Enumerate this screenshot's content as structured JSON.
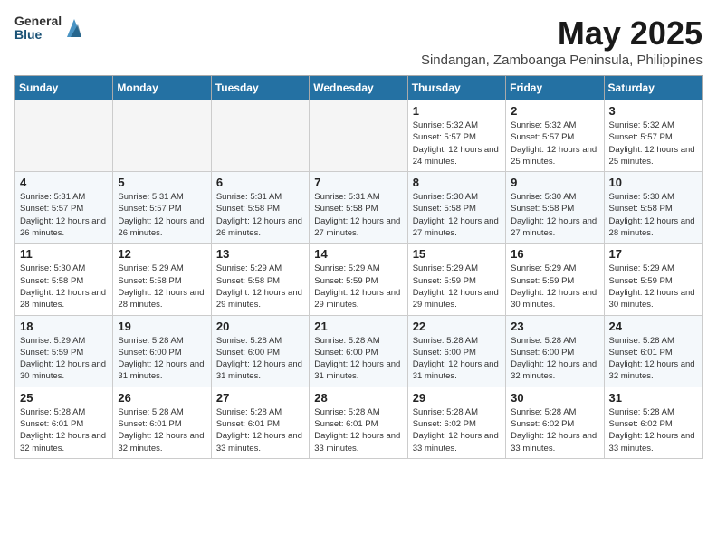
{
  "header": {
    "logo": {
      "general": "General",
      "blue": "Blue"
    },
    "title": "May 2025",
    "location": "Sindangan, Zamboanga Peninsula, Philippines"
  },
  "weekdays": [
    "Sunday",
    "Monday",
    "Tuesday",
    "Wednesday",
    "Thursday",
    "Friday",
    "Saturday"
  ],
  "weeks": [
    [
      {
        "day": "",
        "sunrise": "",
        "sunset": "",
        "daylight": ""
      },
      {
        "day": "",
        "sunrise": "",
        "sunset": "",
        "daylight": ""
      },
      {
        "day": "",
        "sunrise": "",
        "sunset": "",
        "daylight": ""
      },
      {
        "day": "",
        "sunrise": "",
        "sunset": "",
        "daylight": ""
      },
      {
        "day": "1",
        "sunrise": "Sunrise: 5:32 AM",
        "sunset": "Sunset: 5:57 PM",
        "daylight": "Daylight: 12 hours and 24 minutes."
      },
      {
        "day": "2",
        "sunrise": "Sunrise: 5:32 AM",
        "sunset": "Sunset: 5:57 PM",
        "daylight": "Daylight: 12 hours and 25 minutes."
      },
      {
        "day": "3",
        "sunrise": "Sunrise: 5:32 AM",
        "sunset": "Sunset: 5:57 PM",
        "daylight": "Daylight: 12 hours and 25 minutes."
      }
    ],
    [
      {
        "day": "4",
        "sunrise": "Sunrise: 5:31 AM",
        "sunset": "Sunset: 5:57 PM",
        "daylight": "Daylight: 12 hours and 26 minutes."
      },
      {
        "day": "5",
        "sunrise": "Sunrise: 5:31 AM",
        "sunset": "Sunset: 5:57 PM",
        "daylight": "Daylight: 12 hours and 26 minutes."
      },
      {
        "day": "6",
        "sunrise": "Sunrise: 5:31 AM",
        "sunset": "Sunset: 5:58 PM",
        "daylight": "Daylight: 12 hours and 26 minutes."
      },
      {
        "day": "7",
        "sunrise": "Sunrise: 5:31 AM",
        "sunset": "Sunset: 5:58 PM",
        "daylight": "Daylight: 12 hours and 27 minutes."
      },
      {
        "day": "8",
        "sunrise": "Sunrise: 5:30 AM",
        "sunset": "Sunset: 5:58 PM",
        "daylight": "Daylight: 12 hours and 27 minutes."
      },
      {
        "day": "9",
        "sunrise": "Sunrise: 5:30 AM",
        "sunset": "Sunset: 5:58 PM",
        "daylight": "Daylight: 12 hours and 27 minutes."
      },
      {
        "day": "10",
        "sunrise": "Sunrise: 5:30 AM",
        "sunset": "Sunset: 5:58 PM",
        "daylight": "Daylight: 12 hours and 28 minutes."
      }
    ],
    [
      {
        "day": "11",
        "sunrise": "Sunrise: 5:30 AM",
        "sunset": "Sunset: 5:58 PM",
        "daylight": "Daylight: 12 hours and 28 minutes."
      },
      {
        "day": "12",
        "sunrise": "Sunrise: 5:29 AM",
        "sunset": "Sunset: 5:58 PM",
        "daylight": "Daylight: 12 hours and 28 minutes."
      },
      {
        "day": "13",
        "sunrise": "Sunrise: 5:29 AM",
        "sunset": "Sunset: 5:58 PM",
        "daylight": "Daylight: 12 hours and 29 minutes."
      },
      {
        "day": "14",
        "sunrise": "Sunrise: 5:29 AM",
        "sunset": "Sunset: 5:59 PM",
        "daylight": "Daylight: 12 hours and 29 minutes."
      },
      {
        "day": "15",
        "sunrise": "Sunrise: 5:29 AM",
        "sunset": "Sunset: 5:59 PM",
        "daylight": "Daylight: 12 hours and 29 minutes."
      },
      {
        "day": "16",
        "sunrise": "Sunrise: 5:29 AM",
        "sunset": "Sunset: 5:59 PM",
        "daylight": "Daylight: 12 hours and 30 minutes."
      },
      {
        "day": "17",
        "sunrise": "Sunrise: 5:29 AM",
        "sunset": "Sunset: 5:59 PM",
        "daylight": "Daylight: 12 hours and 30 minutes."
      }
    ],
    [
      {
        "day": "18",
        "sunrise": "Sunrise: 5:29 AM",
        "sunset": "Sunset: 5:59 PM",
        "daylight": "Daylight: 12 hours and 30 minutes."
      },
      {
        "day": "19",
        "sunrise": "Sunrise: 5:28 AM",
        "sunset": "Sunset: 6:00 PM",
        "daylight": "Daylight: 12 hours and 31 minutes."
      },
      {
        "day": "20",
        "sunrise": "Sunrise: 5:28 AM",
        "sunset": "Sunset: 6:00 PM",
        "daylight": "Daylight: 12 hours and 31 minutes."
      },
      {
        "day": "21",
        "sunrise": "Sunrise: 5:28 AM",
        "sunset": "Sunset: 6:00 PM",
        "daylight": "Daylight: 12 hours and 31 minutes."
      },
      {
        "day": "22",
        "sunrise": "Sunrise: 5:28 AM",
        "sunset": "Sunset: 6:00 PM",
        "daylight": "Daylight: 12 hours and 31 minutes."
      },
      {
        "day": "23",
        "sunrise": "Sunrise: 5:28 AM",
        "sunset": "Sunset: 6:00 PM",
        "daylight": "Daylight: 12 hours and 32 minutes."
      },
      {
        "day": "24",
        "sunrise": "Sunrise: 5:28 AM",
        "sunset": "Sunset: 6:01 PM",
        "daylight": "Daylight: 12 hours and 32 minutes."
      }
    ],
    [
      {
        "day": "25",
        "sunrise": "Sunrise: 5:28 AM",
        "sunset": "Sunset: 6:01 PM",
        "daylight": "Daylight: 12 hours and 32 minutes."
      },
      {
        "day": "26",
        "sunrise": "Sunrise: 5:28 AM",
        "sunset": "Sunset: 6:01 PM",
        "daylight": "Daylight: 12 hours and 32 minutes."
      },
      {
        "day": "27",
        "sunrise": "Sunrise: 5:28 AM",
        "sunset": "Sunset: 6:01 PM",
        "daylight": "Daylight: 12 hours and 33 minutes."
      },
      {
        "day": "28",
        "sunrise": "Sunrise: 5:28 AM",
        "sunset": "Sunset: 6:01 PM",
        "daylight": "Daylight: 12 hours and 33 minutes."
      },
      {
        "day": "29",
        "sunrise": "Sunrise: 5:28 AM",
        "sunset": "Sunset: 6:02 PM",
        "daylight": "Daylight: 12 hours and 33 minutes."
      },
      {
        "day": "30",
        "sunrise": "Sunrise: 5:28 AM",
        "sunset": "Sunset: 6:02 PM",
        "daylight": "Daylight: 12 hours and 33 minutes."
      },
      {
        "day": "31",
        "sunrise": "Sunrise: 5:28 AM",
        "sunset": "Sunset: 6:02 PM",
        "daylight": "Daylight: 12 hours and 33 minutes."
      }
    ]
  ]
}
